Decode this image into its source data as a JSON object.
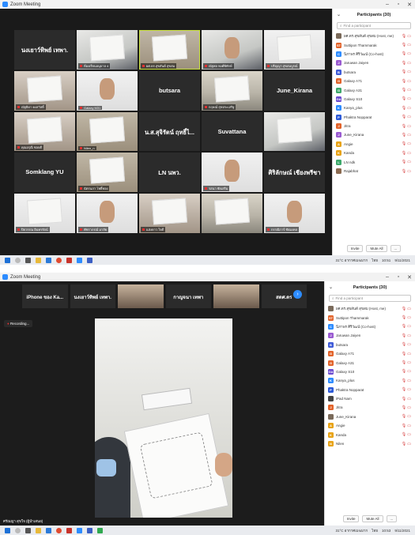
{
  "app": {
    "title": "Zoom Meeting"
  },
  "top": {
    "tiles": [
      {
        "name": "นงเยาว์ทิพย์ เทพา.",
        "caption": "",
        "style": "name"
      },
      {
        "name": "",
        "caption": "ห้องเรียนอนุบาล 4",
        "style": "vid-b"
      },
      {
        "name": "",
        "caption": "ผศ.ดร.สุขสันต์ สุขสม",
        "style": "vid-c",
        "active": true
      },
      {
        "name": "",
        "caption": "ณัฐพล พงศ์พิทักษ์",
        "style": "vid-b"
      },
      {
        "name": "",
        "caption": "ปริญญา สุขสมบูรณ์",
        "style": "vid-d"
      },
      {
        "name": "",
        "caption": "ณัฐธิดา คงสวัสดิ์",
        "style": "vid-e"
      },
      {
        "name": "",
        "caption": "Galaxy M31",
        "style": "vid-d"
      },
      {
        "name": "butsara",
        "caption": "",
        "style": "name"
      },
      {
        "name": "",
        "caption": "กฤษณ์ สุขประเสริฐ",
        "style": "vid-a"
      },
      {
        "name": "June_Kirana",
        "caption": "",
        "style": "name"
      },
      {
        "name": "",
        "caption": "คุณอรุณี ชอบดี",
        "style": "vid-e"
      },
      {
        "name": "",
        "caption": "Nilen_n",
        "style": "vid-c"
      },
      {
        "name": "น.ส.สุจิรัตน์ ฤทธิ์ไ...",
        "caption": "",
        "style": "name"
      },
      {
        "name": "Suvattana",
        "caption": "",
        "style": "name"
      },
      {
        "name": "",
        "caption": "",
        "style": "vid-b"
      },
      {
        "name": "Somklang YU",
        "caption": "",
        "style": "name"
      },
      {
        "name": "",
        "caption": "ฉัตรนภา โพธิ์ทอง",
        "style": "vid-c"
      },
      {
        "name": "LN นพว.",
        "caption": "",
        "style": "name"
      },
      {
        "name": "",
        "caption": "รสนา ชัยเสริม",
        "style": "vid-d"
      },
      {
        "name": "ศิริลักษณ์ เชียงพรีชา",
        "caption": "",
        "style": "name"
      },
      {
        "name": "",
        "caption": "ปิยวรรณ อินทรรัตน์",
        "style": "vid-d"
      },
      {
        "name": "",
        "caption": "พัชราภรณ์ มาลัย",
        "style": "vid-d"
      },
      {
        "name": "",
        "caption": "แสงดาว ใจดี",
        "style": "vid-e"
      },
      {
        "name": "",
        "caption": "",
        "style": "vid-a"
      },
      {
        "name": "",
        "caption": "กรรณิการ์ ชัยมงคล",
        "style": "vid-d"
      }
    ],
    "panel": {
      "title": "Participants (30)",
      "search_placeholder": "Find a participant",
      "participants": [
        {
          "initials": "",
          "name": "ผศ.ดร.สุขสันต์ สุขสม (Host, me)",
          "color": "#7a6a5a"
        },
        {
          "initials": "ST",
          "name": "Suttipon Thammarak",
          "color": "#e2632a"
        },
        {
          "initials": "C",
          "name": "นิภาพร ศิริวัฒน์ (Co-host)",
          "color": "#2d8cff"
        },
        {
          "initials": "J",
          "name": "Jaruwan Jaiyen",
          "color": "#9a5bd1"
        },
        {
          "initials": "B",
          "name": "butsara",
          "color": "#3f5bd8"
        },
        {
          "initials": "G",
          "name": "Galaxy A71",
          "color": "#e2632a"
        },
        {
          "initials": "G",
          "name": "Galaxy A31",
          "color": "#3da86b"
        },
        {
          "initials": "GA",
          "name": "Galaxy S10",
          "color": "#6a4ad0"
        },
        {
          "initials": "K",
          "name": "Kanya_plus",
          "color": "#2d8cff"
        },
        {
          "initials": "P",
          "name": "Phaktra Nopparat",
          "color": "#2d5bd8"
        },
        {
          "initials": "J",
          "name": "Jitra",
          "color": "#e2632a"
        },
        {
          "initials": "J",
          "name": "June_Kirana",
          "color": "#9a5bd1"
        },
        {
          "initials": "A",
          "name": "Angie",
          "color": "#e8a317"
        },
        {
          "initials": "K",
          "name": "Kanda",
          "color": "#e8a317"
        },
        {
          "initials": "L",
          "name": "LN ndk",
          "color": "#3da86b"
        },
        {
          "initials": "",
          "name": "Rajabhat",
          "color": "#8b6a50"
        }
      ],
      "invite_label": "Invite",
      "mute_all_label": "Mute All",
      "more_label": "..."
    },
    "taskbar": {
      "weather": "31°C อากาศเมฆมาก",
      "lang": "ไทย",
      "time": "10:51",
      "date": "9/11/2021"
    }
  },
  "bottom": {
    "strip": [
      {
        "name": "iPhone ของ Ka..."
      },
      {
        "name": "นงเยาว์ทิพย์ เทพา."
      },
      {
        "name": ""
      },
      {
        "name": "กาญจนา เทพา"
      },
      {
        "name": ""
      },
      {
        "name": "สดศ.ดร"
      }
    ],
    "recording_label": "Recording...",
    "active_caption": "ศรัณญา สุขใจ (ผู้นำเสนอ)",
    "panel": {
      "title": "Participants (30)",
      "search_placeholder": "Find a participant",
      "participants": [
        {
          "initials": "",
          "name": "ผศ.ดร.สุขสันต์ สุขสม (Host, me)",
          "color": "#7a6a5a"
        },
        {
          "initials": "ST",
          "name": "Suttipon Thammarak",
          "color": "#e2632a"
        },
        {
          "initials": "C",
          "name": "นิภาพร ศิริวัฒน์ (Co-host)",
          "color": "#2d8cff"
        },
        {
          "initials": "J",
          "name": "Jaruwan Jaiyen",
          "color": "#9a5bd1"
        },
        {
          "initials": "B",
          "name": "butsara",
          "color": "#3f5bd8"
        },
        {
          "initials": "G",
          "name": "Galaxy A71",
          "color": "#e2632a"
        },
        {
          "initials": "G",
          "name": "Galaxy A31",
          "color": "#e2632a"
        },
        {
          "initials": "GA",
          "name": "Galaxy S10",
          "color": "#6a4ad0"
        },
        {
          "initials": "K",
          "name": "Kanya_plus",
          "color": "#2d8cff"
        },
        {
          "initials": "P",
          "name": "Phaktra Nopparat",
          "color": "#2d5bd8"
        },
        {
          "initials": "",
          "name": "iPad Nam",
          "color": "#444444"
        },
        {
          "initials": "J",
          "name": "Jitra",
          "color": "#e2632a"
        },
        {
          "initials": "",
          "name": "June_Kirana",
          "color": "#7a6a5a"
        },
        {
          "initials": "A",
          "name": "Angie",
          "color": "#e8a317"
        },
        {
          "initials": "K",
          "name": "Kanda",
          "color": "#e8a317"
        },
        {
          "initials": "N",
          "name": "Nilen",
          "color": "#e8a317"
        }
      ],
      "invite_label": "Invite",
      "mute_all_label": "Mute All",
      "more_label": "..."
    },
    "taskbar": {
      "weather": "31°C อากาศเมฆมาก",
      "lang": "ไทย",
      "time": "10:53",
      "date": "9/11/2021"
    }
  }
}
